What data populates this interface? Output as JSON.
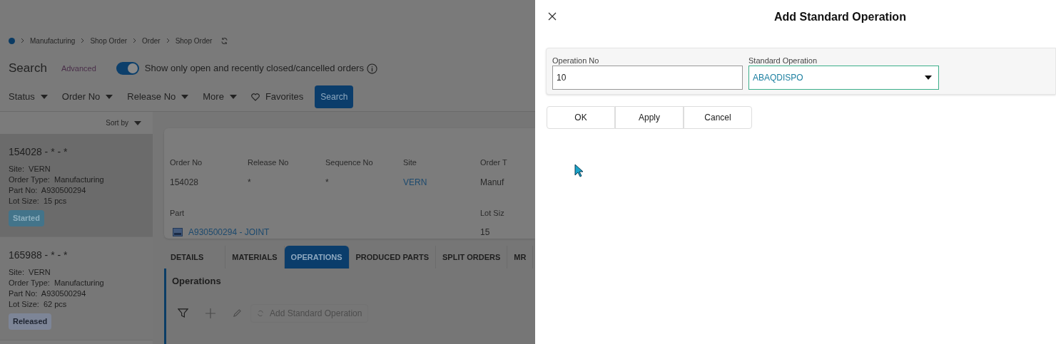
{
  "breadcrumb": [
    "Manufacturing",
    "Shop Order",
    "Order",
    "Shop Order"
  ],
  "search": {
    "title": "Search",
    "advanced": "Advanced",
    "toggle": {
      "on": true,
      "label": "Show only open and recently closed/cancelled orders"
    }
  },
  "filters": [
    {
      "label": "Status",
      "kind": "dropdown"
    },
    {
      "label": "Order No",
      "kind": "dropdown"
    },
    {
      "label": "Release No",
      "kind": "dropdown"
    },
    {
      "label": "More",
      "kind": "dropdown"
    },
    {
      "label": "Favorites",
      "kind": "favorite"
    }
  ],
  "search_button": "Search",
  "sort_label": "Sort by",
  "orders": [
    {
      "title": "154028 - * - *",
      "selected": true,
      "fields": [
        {
          "label": "Site:",
          "value": "VERN"
        },
        {
          "label": "Order Type:",
          "value": "Manufacturing"
        },
        {
          "label": "Part No:",
          "value": "A930500294"
        },
        {
          "label": "Lot Size:",
          "value": "15 pcs"
        }
      ],
      "status": {
        "label": "Started",
        "kind": "started"
      }
    },
    {
      "title": "165988 - * - *",
      "selected": false,
      "fields": [
        {
          "label": "Site:",
          "value": "VERN"
        },
        {
          "label": "Order Type:",
          "value": "Manufacturing"
        },
        {
          "label": "Part No:",
          "value": "A930500294"
        },
        {
          "label": "Lot Size:",
          "value": "62 pcs"
        }
      ],
      "status": {
        "label": "Released",
        "kind": "released"
      }
    }
  ],
  "details": {
    "row_1": [
      {
        "label": "Order No",
        "value": "154028",
        "kind": "text"
      },
      {
        "label": "Release No",
        "value": "*",
        "kind": "text"
      },
      {
        "label": "Sequence No",
        "value": "*",
        "kind": "text"
      },
      {
        "label": "Site",
        "value": "VERN",
        "kind": "link"
      },
      {
        "label": "Order T",
        "value": "Manuf",
        "kind": "text"
      }
    ],
    "row_2": [
      {
        "label": "Part",
        "value": "A930500294 - JOINT",
        "kind": "part_link"
      },
      {
        "label": "Lot Siz",
        "value": "15",
        "kind": "text"
      }
    ]
  },
  "tabs": [
    {
      "label": "DETAILS",
      "selected": false
    },
    {
      "label": "MATERIALS",
      "selected": false
    },
    {
      "label": "OPERATIONS",
      "selected": true
    },
    {
      "label": "PRODUCED PARTS",
      "selected": false
    },
    {
      "label": "SPLIT ORDERS",
      "selected": false
    },
    {
      "label": "MR",
      "selected": false
    }
  ],
  "operations": {
    "title": "Operations",
    "add_button": {
      "label": "Add Standard Operation",
      "disabled": true
    }
  },
  "dialog": {
    "title": "Add Standard Operation",
    "fields": [
      {
        "label": "Operation No",
        "value": "10",
        "kind": "text",
        "focused": false
      },
      {
        "label": "Standard Operation",
        "value": "ABAQDISPO",
        "kind": "dropdown",
        "focused": true
      }
    ],
    "buttons": [
      "OK",
      "Apply",
      "Cancel"
    ]
  }
}
